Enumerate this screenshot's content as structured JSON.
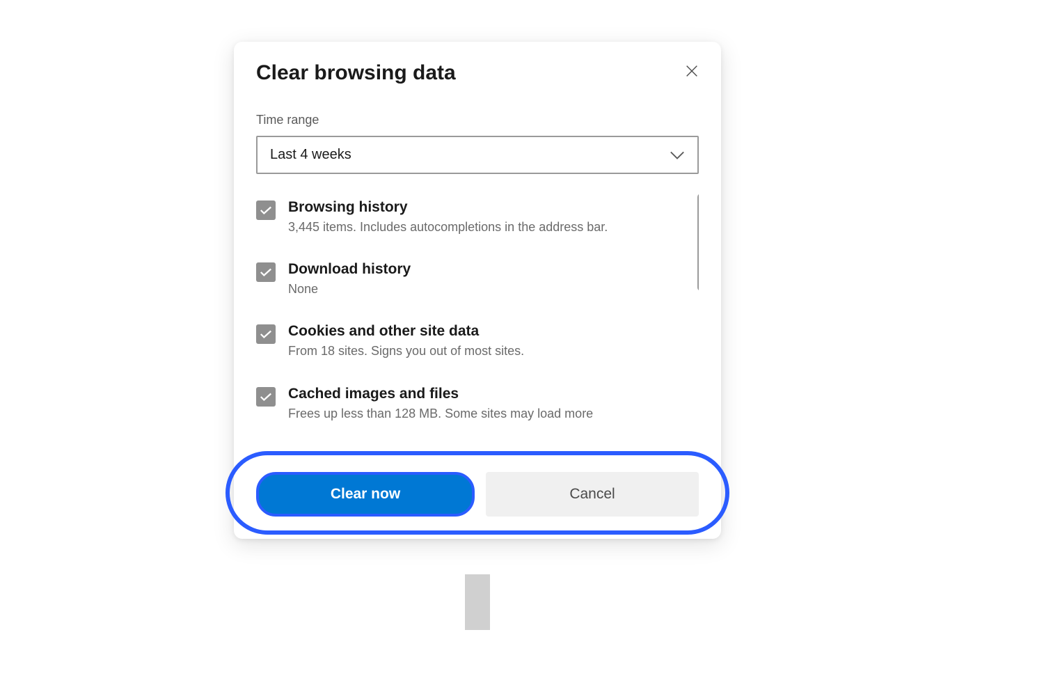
{
  "dialog": {
    "title": "Clear browsing data",
    "timeRange": {
      "label": "Time range",
      "value": "Last 4 weeks"
    },
    "options": [
      {
        "title": "Browsing history",
        "description": "3,445 items. Includes autocompletions in the address bar.",
        "checked": true
      },
      {
        "title": "Download history",
        "description": "None",
        "checked": true
      },
      {
        "title": "Cookies and other site data",
        "description": "From 18 sites. Signs you out of most sites.",
        "checked": true
      },
      {
        "title": "Cached images and files",
        "description": "Frees up less than 128 MB. Some sites may load more",
        "checked": true
      }
    ],
    "buttons": {
      "primary": "Clear now",
      "secondary": "Cancel"
    }
  }
}
